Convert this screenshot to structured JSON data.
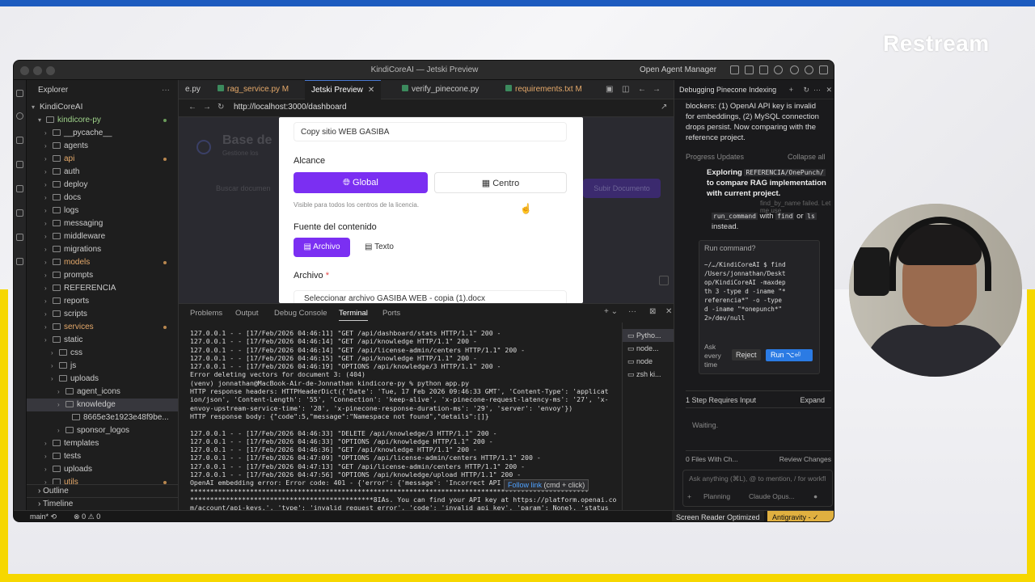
{
  "overlay": {
    "brand": "Restream"
  },
  "window": {
    "title": "KindiCoreAI — Jetski Preview",
    "agent_manager": "Open Agent Manager"
  },
  "sidebar": {
    "header": "Explorer",
    "root": "KindiCoreAI",
    "project": "kindicore-py",
    "items": [
      {
        "label": "__pycache__",
        "depth": 2
      },
      {
        "label": "agents",
        "depth": 2
      },
      {
        "label": "api",
        "depth": 2,
        "color": "orange"
      },
      {
        "label": "auth",
        "depth": 2
      },
      {
        "label": "deploy",
        "depth": 2
      },
      {
        "label": "docs",
        "depth": 2
      },
      {
        "label": "logs",
        "depth": 2
      },
      {
        "label": "messaging",
        "depth": 2
      },
      {
        "label": "middleware",
        "depth": 2
      },
      {
        "label": "migrations",
        "depth": 2
      },
      {
        "label": "models",
        "depth": 2,
        "color": "orange"
      },
      {
        "label": "prompts",
        "depth": 2
      },
      {
        "label": "REFERENCIA",
        "depth": 2
      },
      {
        "label": "reports",
        "depth": 2
      },
      {
        "label": "scripts",
        "depth": 2
      },
      {
        "label": "services",
        "depth": 2,
        "color": "orange"
      },
      {
        "label": "static",
        "depth": 2
      },
      {
        "label": "css",
        "depth": 3
      },
      {
        "label": "js",
        "depth": 3
      },
      {
        "label": "uploads",
        "depth": 3
      },
      {
        "label": "agent_icons",
        "depth": 4
      },
      {
        "label": "knowledge",
        "depth": 4,
        "selected": true
      },
      {
        "label": "8665e3e1923e48f9be...",
        "depth": 5
      },
      {
        "label": "sponsor_logos",
        "depth": 4
      },
      {
        "label": "templates",
        "depth": 2
      },
      {
        "label": "tests",
        "depth": 2
      },
      {
        "label": "uploads",
        "depth": 2
      },
      {
        "label": "utils",
        "depth": 2,
        "color": "orange"
      }
    ],
    "outline": "Outline",
    "timeline": "Timeline"
  },
  "tabs": [
    {
      "label": "e.py",
      "active": false
    },
    {
      "label": "rag_service.py  M",
      "active": false
    },
    {
      "label": "Jetski Preview",
      "active": true
    },
    {
      "label": "verify_pinecone.py",
      "active": false
    },
    {
      "label": "requirements.txt  M",
      "active": false
    }
  ],
  "browser": {
    "url": "http://localhost:3000/dashboard"
  },
  "page": {
    "title_dim": "Base de",
    "subtitle_dim": "Gestione los",
    "search_dim": "Buscar documen",
    "upload_dim": "Subir Documento"
  },
  "modal": {
    "name_value": "Copy sitio WEB GASIBA",
    "scope_label": "Alcance",
    "global_label": "Global",
    "centro_label": "Centro",
    "hint": "Visible para todos los centros de la licencia.",
    "source_label": "Fuente del contenido",
    "archivo_btn": "Archivo",
    "texto_btn": "Texto",
    "file_label": "Archivo",
    "file_required": "*",
    "file_value": "Seleccionar archivo  GASIBA WEB - copia (1).docx"
  },
  "panel": {
    "tabs": [
      "Problems",
      "Output",
      "Debug Console",
      "Terminal",
      "Ports"
    ],
    "active_tab": "Terminal"
  },
  "terminal": {
    "lines": [
      "127.0.0.1 - - [17/Feb/2026 04:46:11] \"GET /api/dashboard/stats HTTP/1.1\" 200 -",
      "127.0.0.1 - - [17/Feb/2026 04:46:14] \"GET /api/knowledge HTTP/1.1\" 200 -",
      "127.0.0.1 - - [17/Feb/2026 04:46:14] \"GET /api/license-admin/centers HTTP/1.1\" 200 -",
      "127.0.0.1 - - [17/Feb/2026 04:46:15] \"GET /api/knowledge HTTP/1.1\" 200 -",
      "127.0.0.1 - - [17/Feb/2026 04:46:19] \"OPTIONS /api/knowledge/3 HTTP/1.1\" 200 -",
      "Error deleting vectors for document 3: (404)",
      "(venv) jonnathan@MacBook-Air-de-Jonnathan kindicore-py % python app.py",
      "HTTP response headers: HTTPHeaderDict({'Date': 'Tue, 17 Feb 2026 09:46:33 GMT', 'Content-Type': 'applicat",
      "ion/json', 'Content-Length': '55', 'Connection': 'keep-alive', 'x-pinecone-request-latency-ms': '27', 'x-",
      "envoy-upstream-service-time': '28', 'x-pinecone-response-duration-ms': '29', 'server': 'envoy'})",
      "HTTP response body: {\"code\":5,\"message\":\"Namespace not found\",\"details\":[]}",
      "",
      "127.0.0.1 - - [17/Feb/2026 04:46:33] \"DELETE /api/knowledge/3 HTTP/1.1\" 200 -",
      "127.0.0.1 - - [17/Feb/2026 04:46:33] \"OPTIONS /api/knowledge HTTP/1.1\" 200 -",
      "127.0.0.1 - - [17/Feb/2026 04:46:36] \"GET /api/knowledge HTTP/1.1\" 200 -",
      "127.0.0.1 - - [17/Feb/2026 04:47:09] \"OPTIONS /api/license-admin/centers HTTP/1.1\" 200 -",
      "127.0.0.1 - - [17/Feb/2026 04:47:13] \"GET /api/license-admin/centers HTTP/1.1\" 200 -",
      "127.0.0.1 - - [17/Feb/2026 04:47:56] \"OPTIONS /api/knowledge/upload HTTP/1.1\" 200 -",
      "OpenAI embedding error: Error code: 401 - {'error': {'message': 'Incorrect API",
      "****************************************************************************************************",
      "**********************************************8IAs. You can find your API key at https://platform.openai.co",
      "m/account/api-keys.', 'type': 'invalid_request_error', 'code': 'invalid_api_key', 'param': None}, 'status"
    ],
    "tooltip_link": "Follow link",
    "tooltip_hint": "(cmd + click)",
    "sessions": [
      "Pytho...",
      "node...",
      "node",
      "zsh ki..."
    ]
  },
  "agent": {
    "title": "Debugging Pinecone Indexing",
    "intro": "blockers: (1) OpenAI API key is invalid for embeddings, (2) MySQL connection drops persist. Now comparing with the reference project.",
    "progress_label": "Progress Updates",
    "collapse_label": "Collapse all",
    "exploring_prefix": "Exploring",
    "exploring_code": "REFERENCIA/OnePunch/",
    "exploring_suffix": "to compare RAG implementation with current project.",
    "tool_note": "find_by_name failed. Let me use",
    "tool_code1": "run_command",
    "tool_with": "with",
    "tool_code2": "find",
    "tool_or": "or",
    "tool_code3": "ls",
    "tool_end": "instead.",
    "run_title": "Run command?",
    "run_cmd": "~/…/KindiCoreAI $ find\n/Users/jonnathan/Deskt\nop/KindiCoreAI -maxdep\nth 3 -type d -iname \"*\nreferencia*\" -o -type\nd -iname \"*onepunch*\"\n2>/dev/null",
    "ask_label": "Ask\nevery\ntime",
    "reject_label": "Reject",
    "run_label": "Run ⌥⏎",
    "step_label": "1 Step Requires Input",
    "expand_label": "Expand",
    "waiting": "Waiting.",
    "files_label": "0 Files With Ch...",
    "review_label": "Review Changes",
    "input_placeholder": "Ask anything (⌘L), @ to mention, / for workfl",
    "mode_label": "Planning",
    "model_label": "Claude Opus..."
  },
  "statusbar": {
    "branch": "main*",
    "errors": "0",
    "warnings": "0",
    "screen_reader": "Screen Reader Optimized",
    "antigravity": "Antigravity - ✓"
  },
  "colors": {
    "accent_purple": "#7b2ff2",
    "run_blue": "#2b7be4",
    "status_gold": "#e0b040"
  }
}
